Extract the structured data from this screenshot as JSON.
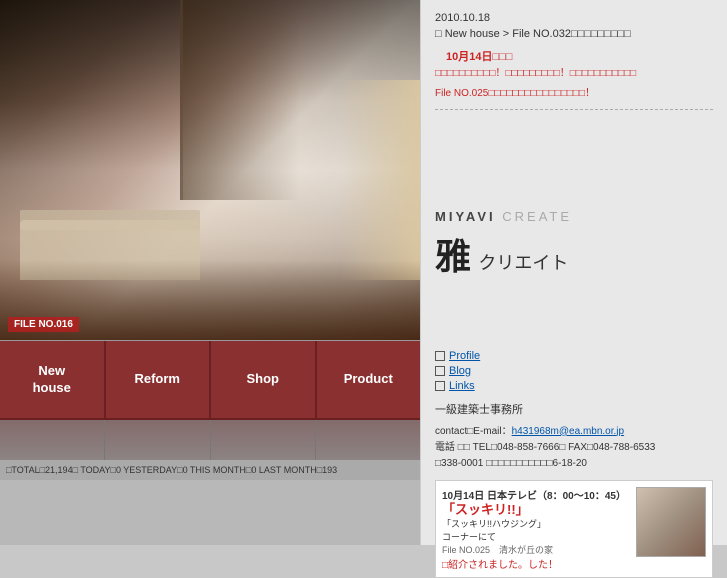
{
  "header": {
    "date": "2010.10.18",
    "breadcrumb": "□ New house > File NO.032□□□□□□□□□",
    "news_date": "　10月14日□□□",
    "news_body": "□□□□□□□□□□！□□□□□□□□□！□□□□□□□□□□□",
    "news_file": "File NO.025□□□□□□□□□□□□□□□□！",
    "file_label": "FILE NO.016"
  },
  "brand": {
    "miyavi_create": "MIYAVI CREATE",
    "miyavi": "MIYAVI",
    "create": "CREATE",
    "kanji": "雅",
    "katakana": "クリエイト"
  },
  "nav": {
    "buttons": [
      {
        "label": "New\nhouse"
      },
      {
        "label": "Reform"
      },
      {
        "label": "Shop"
      },
      {
        "label": "Product"
      }
    ]
  },
  "links": [
    {
      "label": "Profile"
    },
    {
      "label": "Blog"
    },
    {
      "label": "Links"
    }
  ],
  "contact": {
    "company": "一級建築士事務所",
    "contact_label": "contact□E-mail：",
    "email": "h431968m@ea.mbn.or.jp",
    "tel": "電話 □□ TEL□048-858-7666□ FAX□048-788-6533",
    "address": "□338-0001 □□□□□□□□□□□6-18-20"
  },
  "promo": {
    "date": "10月14日 日本テレビ（8：00～10：45）",
    "title": "「スッキリ!!」",
    "sub": "「スッキリ!!ハウジング」",
    "corner": "コーナーにて",
    "file": "File NO.025　清水が丘の家",
    "more": "□紹介されました。した！"
  },
  "stats": {
    "text": "□TOTAL□21,194□ TODAY□0 YESTERDAY□0 THIS MONTH□0 LAST MONTH□193"
  }
}
